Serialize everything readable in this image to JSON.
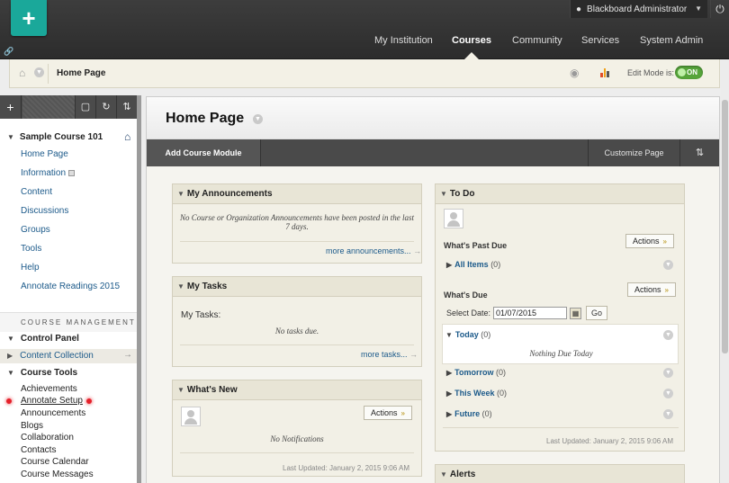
{
  "header": {
    "user": "Blackboard Administrator",
    "tabs": [
      {
        "label": "My Institution"
      },
      {
        "label": "Courses"
      },
      {
        "label": "Community"
      },
      {
        "label": "Services"
      },
      {
        "label": "System Admin"
      }
    ]
  },
  "breadcrumb": {
    "title": "Home Page",
    "edit_mode_label": "Edit Mode is:",
    "edit_mode_state": "ON"
  },
  "sidebar": {
    "course_title": "Sample Course 101",
    "menu": [
      "Home Page",
      "Information",
      "Content",
      "Discussions",
      "Groups",
      "Tools",
      "Help",
      "Annotate Readings 2015"
    ],
    "course_management": "COURSE MANAGEMENT",
    "control_panel": "Control Panel",
    "content_collection": "Content Collection",
    "course_tools": "Course Tools",
    "tools": [
      "Achievements",
      "Annotate Setup",
      "Announcements",
      "Blogs",
      "Collaboration",
      "Contacts",
      "Course Calendar",
      "Course Messages"
    ]
  },
  "main": {
    "title": "Home Page",
    "add_module": "Add Course Module",
    "customize": "Customize Page",
    "announcements": {
      "title": "My Announcements",
      "note": "No Course or Organization Announcements have been posted in the last 7 days.",
      "more": "more announcements..."
    },
    "tasks": {
      "title": "My Tasks",
      "label": "My Tasks:",
      "note": "No tasks due.",
      "more": "more tasks..."
    },
    "whats_new": {
      "title": "What's New",
      "actions": "Actions",
      "note": "No Notifications",
      "updated": "Last Updated: January 2, 2015 9:06 AM"
    },
    "todo": {
      "title": "To Do",
      "past_due": "What's Past Due",
      "actions": "Actions",
      "all_items": "All Items",
      "all_items_count": "(0)",
      "whats_due": "What's Due",
      "select_date": "Select Date:",
      "date_value": "01/07/2015",
      "go": "Go",
      "today": "Today",
      "today_count": "(0)",
      "nothing_due": "Nothing Due Today",
      "tomorrow": "Tomorrow",
      "tomorrow_count": "(0)",
      "this_week": "This Week",
      "this_week_count": "(0)",
      "future": "Future",
      "future_count": "(0)",
      "updated": "Last Updated: January 2, 2015 9:06 AM"
    },
    "alerts": {
      "title": "Alerts"
    }
  },
  "colors": {
    "brand": "#1aa89a",
    "link": "#1c5a8a",
    "toggle_on": "#56a43a",
    "dark_bar": "#4a4a4a"
  }
}
